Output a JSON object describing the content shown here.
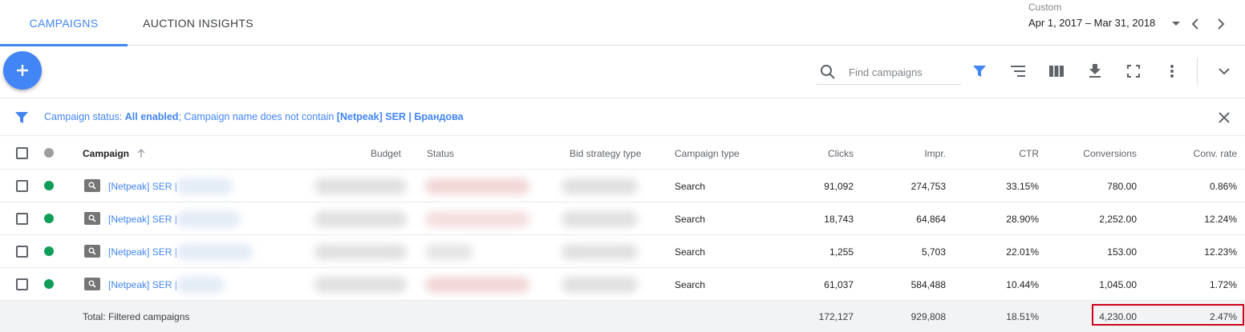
{
  "tabs": [
    {
      "label": "CAMPAIGNS",
      "active": true
    },
    {
      "label": "AUCTION INSIGHTS",
      "active": false
    }
  ],
  "date_range": {
    "label": "Custom",
    "value": "Apr 1, 2017 – Mar 31, 2018"
  },
  "toolbar": {
    "add_icon": "plus-icon",
    "search_placeholder": "Find campaigns",
    "icons": [
      "search-icon",
      "filter-icon",
      "segment-icon",
      "columns-icon",
      "download-icon",
      "fullscreen-icon",
      "more-vert-icon",
      "chevron-down-icon"
    ]
  },
  "filter": {
    "prefix": "Campaign status: ",
    "status_value": "All enabled",
    "middle": "; Campaign name does not contain ",
    "name_value": "[Netpeak] SER | Брандова"
  },
  "table": {
    "columns": [
      "Campaign",
      "Budget",
      "Status",
      "Bid strategy type",
      "Campaign type",
      "Clicks",
      "Impr.",
      "CTR",
      "Conversions",
      "Conv. rate"
    ],
    "rows": [
      {
        "campaign": "[Netpeak] SER |",
        "campaign_type": "Search",
        "clicks": "91,092",
        "impr": "274,753",
        "ctr": "33.15%",
        "conversions": "780.00",
        "conv_rate": "0.86%"
      },
      {
        "campaign": "[Netpeak] SER |",
        "campaign_type": "Search",
        "clicks": "18,743",
        "impr": "64,864",
        "ctr": "28.90%",
        "conversions": "2,252.00",
        "conv_rate": "12.24%"
      },
      {
        "campaign": "[Netpeak] SER |",
        "campaign_type": "Search",
        "clicks": "1,255",
        "impr": "5,703",
        "ctr": "22.01%",
        "conversions": "153.00",
        "conv_rate": "12.23%"
      },
      {
        "campaign": "[Netpeak] SER |",
        "campaign_type": "Search",
        "clicks": "61,037",
        "impr": "584,488",
        "ctr": "10.44%",
        "conversions": "1,045.00",
        "conv_rate": "1.72%"
      }
    ],
    "total": {
      "label": "Total: Filtered campaigns",
      "clicks": "172,127",
      "impr": "929,808",
      "ctr": "18.51%",
      "conversions": "4,230.00",
      "conv_rate": "2.47%"
    }
  },
  "colors": {
    "accent": "#4285f4",
    "enabled_status": "#0f9d58",
    "highlight_box": "#d0021b"
  }
}
